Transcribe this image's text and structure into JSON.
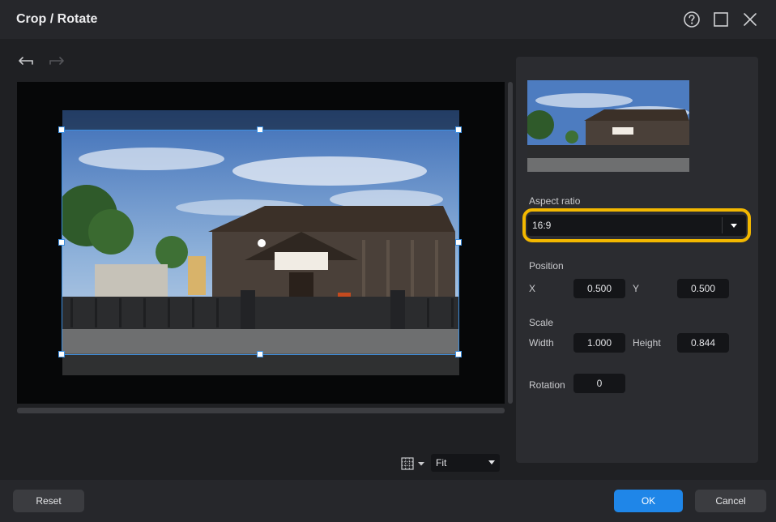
{
  "window": {
    "title": "Crop / Rotate",
    "help_icon": "question-circle-icon",
    "maximize_icon": "maximize-icon",
    "close_icon": "close-icon"
  },
  "toolbar": {
    "undo_icon": "undo-arrow-icon",
    "redo_icon": "redo-arrow-icon"
  },
  "preview": {
    "zoom_value": "Fit",
    "grid_icon": "grid-icon"
  },
  "panel": {
    "aspect_ratio_label": "Aspect ratio",
    "aspect_ratio_value": "16:9",
    "position_label": "Position",
    "x_label": "X",
    "x_value": "0.500",
    "y_label": "Y",
    "y_value": "0.500",
    "scale_label": "Scale",
    "width_label": "Width",
    "width_value": "1.000",
    "height_label": "Height",
    "height_value": "0.844",
    "rotation_label": "Rotation",
    "rotation_value": "0"
  },
  "footer": {
    "reset_label": "Reset",
    "ok_label": "OK",
    "cancel_label": "Cancel"
  },
  "colors": {
    "accent": "#1f86e8",
    "highlight": "#f3b800",
    "crop_border": "#3d8fe0"
  }
}
